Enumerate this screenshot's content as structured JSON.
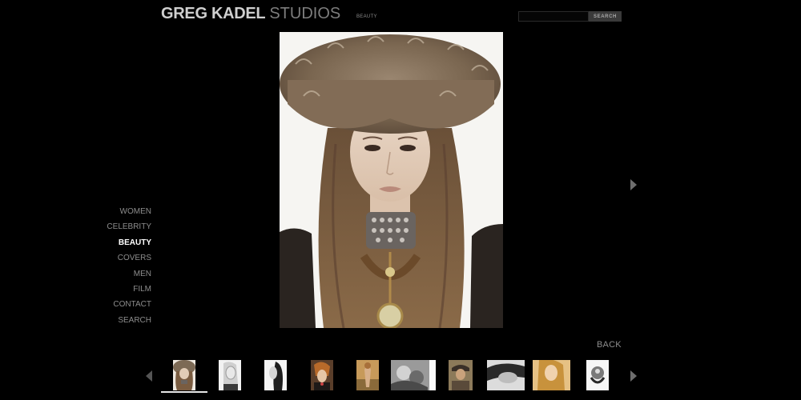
{
  "header": {
    "logo_primary": "GREG KADEL",
    "logo_secondary": "STUDIOS",
    "section": "BEAUTY"
  },
  "search": {
    "button_label": "SEARCH",
    "placeholder": ""
  },
  "nav": {
    "items": [
      {
        "label": "WOMEN",
        "active": false
      },
      {
        "label": "CELEBRITY",
        "active": false
      },
      {
        "label": "BEAUTY",
        "active": true
      },
      {
        "label": "COVERS",
        "active": false
      },
      {
        "label": "MEN",
        "active": false
      },
      {
        "label": "FILM",
        "active": false
      },
      {
        "label": "CONTACT",
        "active": false
      },
      {
        "label": "SEARCH",
        "active": false
      }
    ]
  },
  "gallery": {
    "back_label": "BACK",
    "selected_thumbnail": 1,
    "thumbnail_count": 10
  },
  "colors": {
    "background": "#000000",
    "nav_text": "#8d8d8d",
    "nav_active": "#ffffff"
  }
}
